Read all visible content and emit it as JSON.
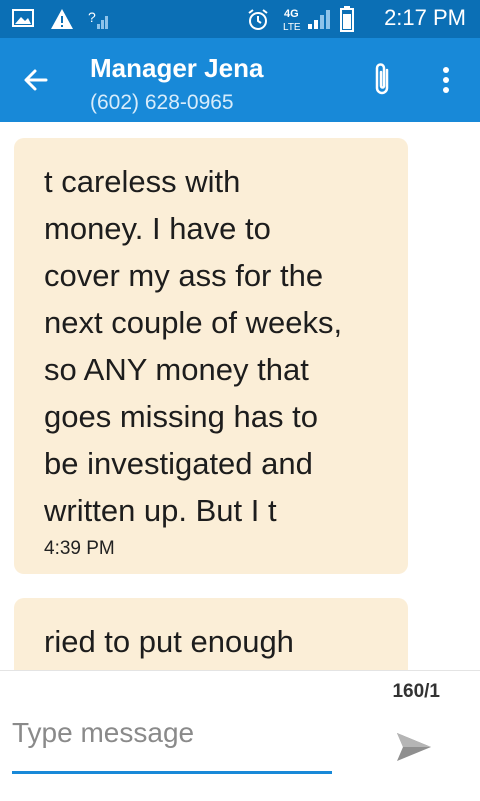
{
  "status_bar": {
    "time": "2:17 PM",
    "network_label": "4G LTE",
    "icons": [
      "image-icon",
      "warning-icon",
      "signal-unknown-icon",
      "alarm-icon",
      "network-4g-lte-icon",
      "signal-icon",
      "battery-icon"
    ]
  },
  "header": {
    "title": "Manager Jena",
    "subtitle": "(602) 628-0965",
    "icons": [
      "back-arrow-icon",
      "paperclip-icon",
      "more-vert-icon"
    ]
  },
  "messages": [
    {
      "text": "t careless with\nmoney. I have to\ncover my ass for the\nnext couple of weeks,\nso ANY money that\ngoes missing has to\nbe investigated and\nwritten up. But I t",
      "time": "4:39 PM"
    },
    {
      "text": "ried to put enough",
      "time": ""
    }
  ],
  "composer": {
    "counter": "160/1",
    "placeholder": "Type message",
    "send_icon": "send-icon"
  },
  "colors": {
    "status_bar": "#0b6fb5",
    "app_bar": "#1889d8",
    "bubble": "#fbeed7",
    "accent": "#1889d8"
  }
}
